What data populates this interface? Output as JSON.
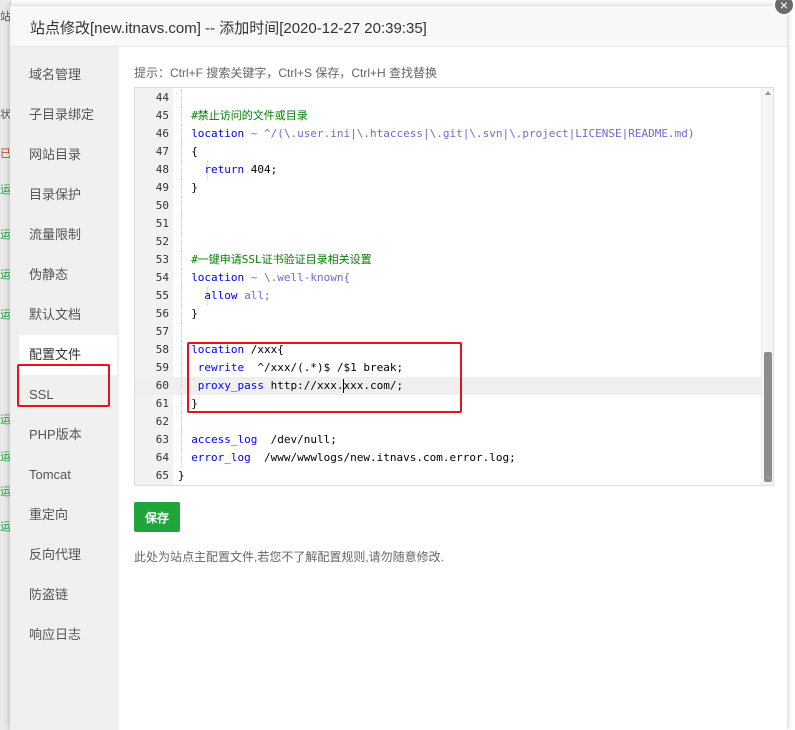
{
  "dialog": {
    "title": "站点修改[new.itnavs.com] -- 添加时间[2020-12-27 20:39:35]",
    "close_icon": "×"
  },
  "background_marks": [
    {
      "text": "站",
      "color": "#555555"
    },
    {
      "text": "状",
      "color": "#555555"
    },
    {
      "text": "已",
      "color": "#c0392b"
    },
    {
      "text": "运",
      "color": "#20a53a"
    },
    {
      "text": "运",
      "color": "#20a53a"
    },
    {
      "text": "运",
      "color": "#20a53a"
    },
    {
      "text": "运",
      "color": "#20a53a"
    },
    {
      "text": "运",
      "color": "#20a53a"
    },
    {
      "text": "运",
      "color": "#20a53a"
    },
    {
      "text": "运",
      "color": "#20a53a"
    },
    {
      "text": "运",
      "color": "#20a53a"
    }
  ],
  "sidebar": {
    "items": [
      {
        "label": "域名管理"
      },
      {
        "label": "子目录绑定"
      },
      {
        "label": "网站目录"
      },
      {
        "label": "目录保护"
      },
      {
        "label": "流量限制"
      },
      {
        "label": "伪静态"
      },
      {
        "label": "默认文档"
      },
      {
        "label": "配置文件",
        "active": true
      },
      {
        "label": "SSL"
      },
      {
        "label": "PHP版本"
      },
      {
        "label": "Tomcat"
      },
      {
        "label": "重定向"
      },
      {
        "label": "反向代理"
      },
      {
        "label": "防盗链"
      },
      {
        "label": "响应日志"
      }
    ]
  },
  "content": {
    "hint": "提示：Ctrl+F 搜索关键字，Ctrl+S 保存，Ctrl+H 查找替换",
    "save_label": "保存",
    "note": "此处为站点主配置文件,若您不了解配置规则,请勿随意修改."
  },
  "editor": {
    "active_line": "60",
    "lines": [
      {
        "num": "44",
        "text": ""
      },
      {
        "num": "45",
        "text": "#禁止访问的文件或目录"
      },
      {
        "num": "46",
        "text": "location ~ ^/(\\.user.ini|\\.htaccess|\\.git|\\.svn|\\.project|LICENSE|README.md)"
      },
      {
        "num": "47",
        "text": "{"
      },
      {
        "num": "48",
        "text": "return 404;"
      },
      {
        "num": "49",
        "text": "}"
      },
      {
        "num": "50",
        "text": ""
      },
      {
        "num": "51",
        "text": ""
      },
      {
        "num": "52",
        "text": ""
      },
      {
        "num": "53",
        "text": "#一键申请SSL证书验证目录相关设置"
      },
      {
        "num": "54",
        "text": "location ~ \\.well-known{"
      },
      {
        "num": "55",
        "text": "allow all;"
      },
      {
        "num": "56",
        "text": "}"
      },
      {
        "num": "57",
        "text": ""
      },
      {
        "num": "58",
        "text": "location /xxx{"
      },
      {
        "num": "59",
        "text": "rewrite  ^/xxx/(.*)$ /$1 break;"
      },
      {
        "num": "60",
        "text": "proxy_pass http://xxx.xxx.com/;"
      },
      {
        "num": "61",
        "text": "}"
      },
      {
        "num": "62",
        "text": ""
      },
      {
        "num": "63",
        "text": "access_log  /dev/null;"
      },
      {
        "num": "64",
        "text": "error_log  /www/wwwlogs/new.itnavs.com.error.log;"
      },
      {
        "num": "65",
        "text": "}"
      }
    ]
  }
}
